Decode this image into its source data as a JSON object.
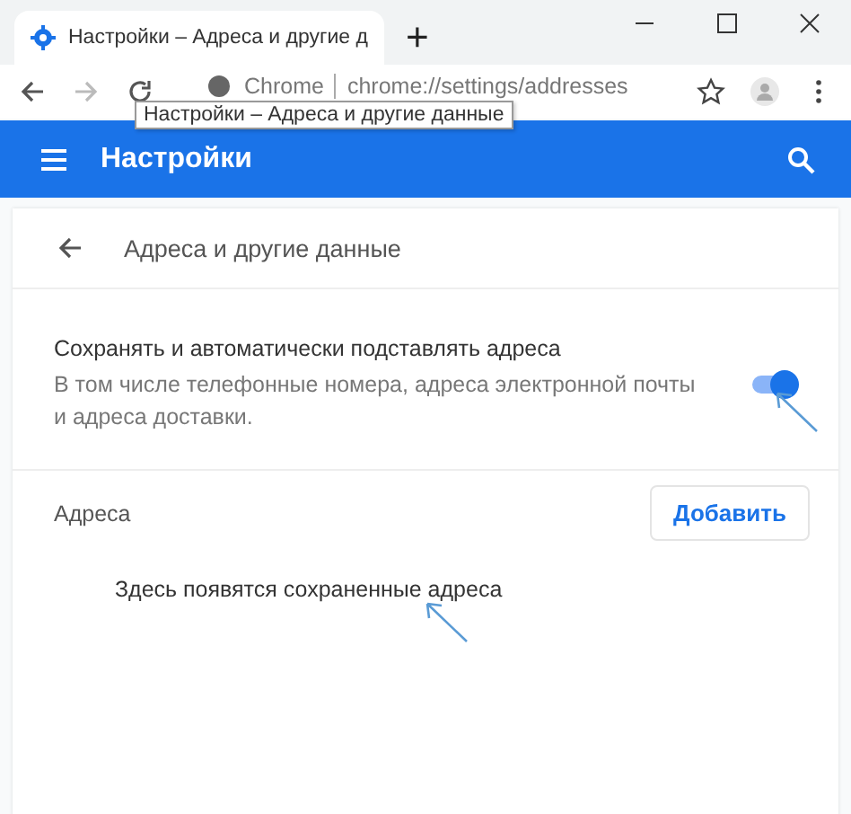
{
  "browser": {
    "tab": {
      "title": "Настройки – Адреса и другие д",
      "selected": true
    },
    "new_tab": "+",
    "site_label": "Chrome",
    "url": "chrome://settings/addresses",
    "tooltip": "Настройки – Адреса и другие данные"
  },
  "header": {
    "title": "Настройки"
  },
  "page": {
    "title": "Адреса и другие данные",
    "setting": {
      "label": "Сохранять и автоматически подставлять адреса",
      "description": "В том числе телефонные номера, адреса электронной почты и адреса доставки.",
      "on": true
    },
    "section": {
      "title": "Адреса",
      "button": "Добавить",
      "empty": "Здесь появятся сохраненные адреса"
    }
  }
}
